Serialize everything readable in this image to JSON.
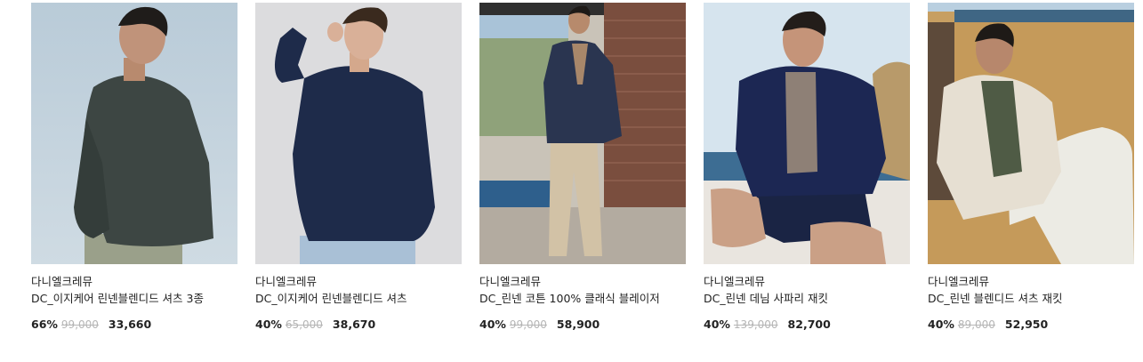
{
  "products": [
    {
      "brand": "다니엘크레뮤",
      "title": "DC_이지케어 린넨블렌디드 셔츠 3종",
      "discount": "66%",
      "original_price": "99,000",
      "sale_price": "33,660",
      "image_alt": "dark green linen shirt"
    },
    {
      "brand": "다니엘크레뮤",
      "title": "DC_이지케어 린넨블렌디드 셔츠",
      "discount": "40%",
      "original_price": "65,000",
      "sale_price": "38,670",
      "image_alt": "navy linen shirt"
    },
    {
      "brand": "다니엘크레뮤",
      "title": "DC_린넨 코튼 100% 클래식 블레이저",
      "discount": "40%",
      "original_price": "99,000",
      "sale_price": "58,900",
      "image_alt": "navy blazer with beige trousers"
    },
    {
      "brand": "다니엘크레뮤",
      "title": "DC_린넨 데님 사파리 재킷",
      "discount": "40%",
      "original_price": "139,000",
      "sale_price": "82,700",
      "image_alt": "navy denim safari jacket"
    },
    {
      "brand": "다니엘크레뮤",
      "title": "DC_린넨 블렌디드 셔츠 재킷",
      "discount": "40%",
      "original_price": "89,000",
      "sale_price": "52,950",
      "image_alt": "beige linen shirt jacket"
    }
  ],
  "colors": {
    "text": "#222222",
    "strike": "#b5b5b5"
  }
}
